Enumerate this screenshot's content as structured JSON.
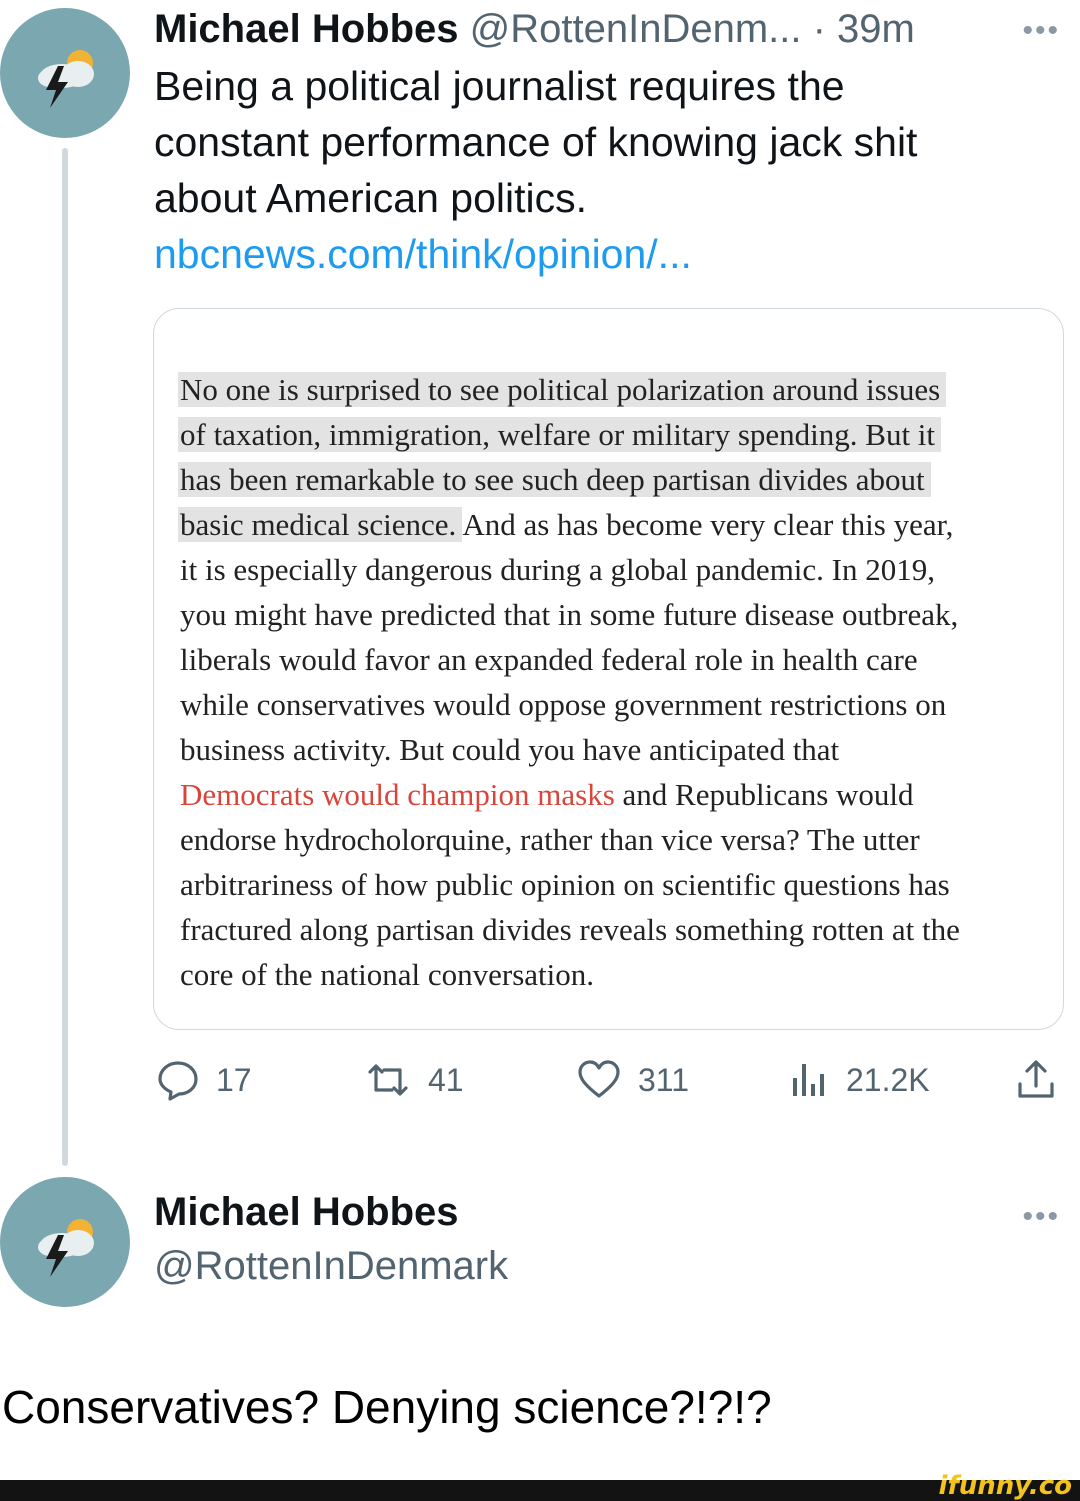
{
  "tweet": {
    "author_name": "Michael Hobbes",
    "author_handle": "@RottenInDenm...",
    "separator": " · ",
    "time": "39m",
    "more_label": "•••",
    "text_lines": [
      "Being a political journalist requires the",
      "constant performance of knowing jack shit",
      "about American politics."
    ],
    "link": "nbcnews.com/think/opinion/...",
    "article": {
      "highlighted_lines": [
        "No one is surprised to see political polarization around issues",
        "of taxation, immigration, welfare or military spending. But it",
        "has been remarkable to see such deep partisan divides about",
        "basic medical science."
      ],
      "line4_rest": " And as has become very clear this year,",
      "lines": [
        "it is especially dangerous during a global pandemic. In 2019,",
        "you might have predicted that in some future disease outbreak,",
        "liberals would favor an expanded federal role in health care",
        "while conservatives would oppose government restrictions on",
        "business activity. But could you have anticipated that"
      ],
      "red_phrase": "Democrats would champion masks",
      "red_line_rest": " and Republicans would",
      "final_lines": [
        "endorse hydrocholorquine, rather than vice versa? The utter",
        "arbitrariness of how public opinion on scientific questions has",
        "fractured along partisan divides reveals something rotten at the",
        "core of the national conversation."
      ]
    },
    "actions": {
      "replies": "17",
      "retweets": "41",
      "likes": "311",
      "views": "21.2K"
    }
  },
  "reply": {
    "author_name": "Michael Hobbes",
    "author_handle": "@RottenInDenmark",
    "more_label": "•••"
  },
  "caption": "Conservatives? Denying science?!?!?",
  "watermark": "ifunny.co",
  "colors": {
    "link": "#1d9bf0",
    "avatar_bg": "#7ba7b0",
    "article_link": "#d8453a"
  }
}
